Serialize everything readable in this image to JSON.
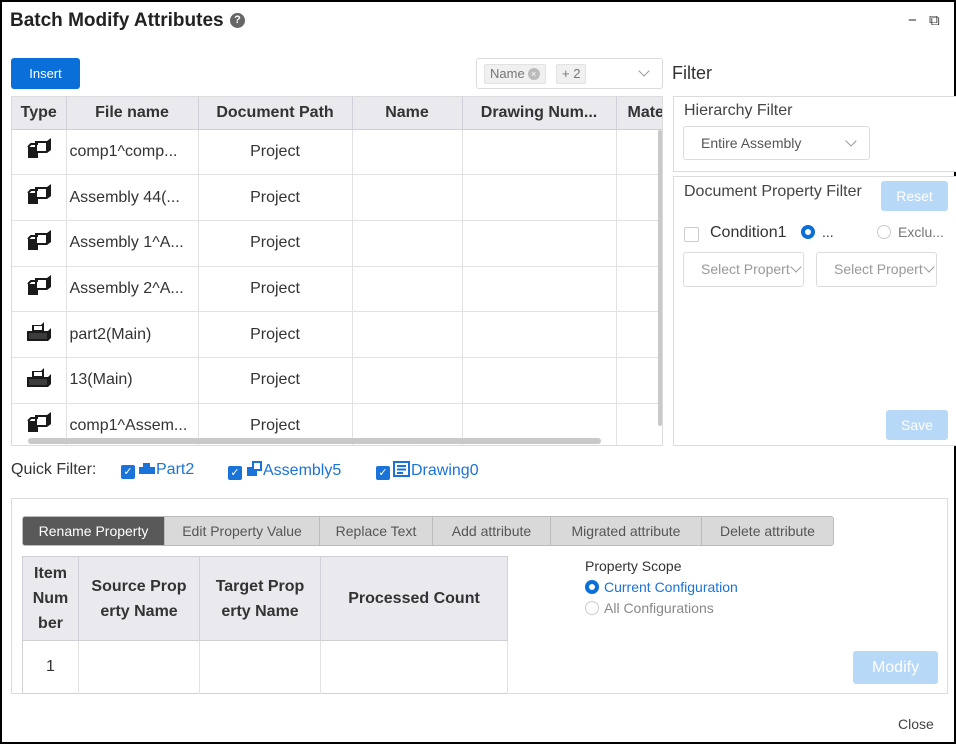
{
  "window": {
    "title": "Batch Modify Attributes",
    "help": "?",
    "minimize": "−",
    "restore": "⧉"
  },
  "toolbar": {
    "insert_label": "Insert"
  },
  "column_selector": {
    "tag": "Name",
    "tag_remove": "×",
    "more": "+ 2"
  },
  "grid": {
    "columns": [
      "Type",
      "File name",
      "Document Path",
      "Name",
      "Drawing Num...",
      "Mate"
    ],
    "rows": [
      {
        "icon": "assembly-icon",
        "file_name": "comp1^comp...",
        "path": "Project",
        "name": "",
        "drawing": "",
        "mate": ""
      },
      {
        "icon": "assembly-icon",
        "file_name": "Assembly 44(...",
        "path": "Project",
        "name": "",
        "drawing": "",
        "mate": ""
      },
      {
        "icon": "assembly-icon",
        "file_name": "Assembly 1^A...",
        "path": "Project",
        "name": "",
        "drawing": "",
        "mate": ""
      },
      {
        "icon": "assembly-icon",
        "file_name": "Assembly 2^A...",
        "path": "Project",
        "name": "",
        "drawing": "",
        "mate": ""
      },
      {
        "icon": "part-icon",
        "file_name": "part2(Main)",
        "path": "Project",
        "name": "",
        "drawing": "",
        "mate": ""
      },
      {
        "icon": "part-icon",
        "file_name": "13(Main)",
        "path": "Project",
        "name": "",
        "drawing": "",
        "mate": ""
      },
      {
        "icon": "assembly-icon",
        "file_name": "comp1^Assem...",
        "path": "Project",
        "name": "",
        "drawing": "",
        "mate": ""
      }
    ]
  },
  "filter": {
    "title": "Filter",
    "hierarchy": {
      "title": "Hierarchy Filter",
      "value": "Entire Assembly"
    },
    "doc_prop": {
      "title": "Document Property Filter",
      "reset": "Reset",
      "condition": "Condition1",
      "include": "...",
      "exclude": "Exclu...",
      "select1": "Select Propert",
      "select2": "Select Propert",
      "save": "Save"
    }
  },
  "quick_filter": {
    "label": "Quick Filter:",
    "items": [
      {
        "label": "Part2",
        "icon": "part-icon",
        "checked": true
      },
      {
        "label": "Assembly5",
        "icon": "assembly-icon",
        "checked": true
      },
      {
        "label": "Drawing0",
        "icon": "drawing-icon",
        "checked": true
      }
    ]
  },
  "tabs": [
    "Rename Property",
    "Edit Property Value",
    "Replace Text",
    "Add attribute",
    "Migrated attribute",
    "Delete attribute"
  ],
  "active_tab": "Rename Property",
  "prop_table": {
    "headers": [
      "Item Num ber",
      "Source Prop erty Name",
      "Target Prop erty Name",
      "Processed Count"
    ],
    "header_lines": [
      [
        "Item",
        "Num",
        "ber"
      ],
      [
        "Source Prop",
        "erty Name"
      ],
      [
        "Target Prop",
        "erty Name"
      ],
      [
        "Processed Count"
      ]
    ],
    "rows": [
      [
        "1",
        "",
        "",
        ""
      ]
    ]
  },
  "scope": {
    "title": "Property Scope",
    "current": "Current Configuration",
    "all": "All Configurations",
    "selected": "Current Configuration"
  },
  "modify_label": "Modify",
  "close_label": "Close",
  "colors": {
    "primary": "#0a6fd8",
    "primary_disabled": "#b8d8f8",
    "link": "#1a73d8",
    "header_bg": "#e9e9ee"
  }
}
